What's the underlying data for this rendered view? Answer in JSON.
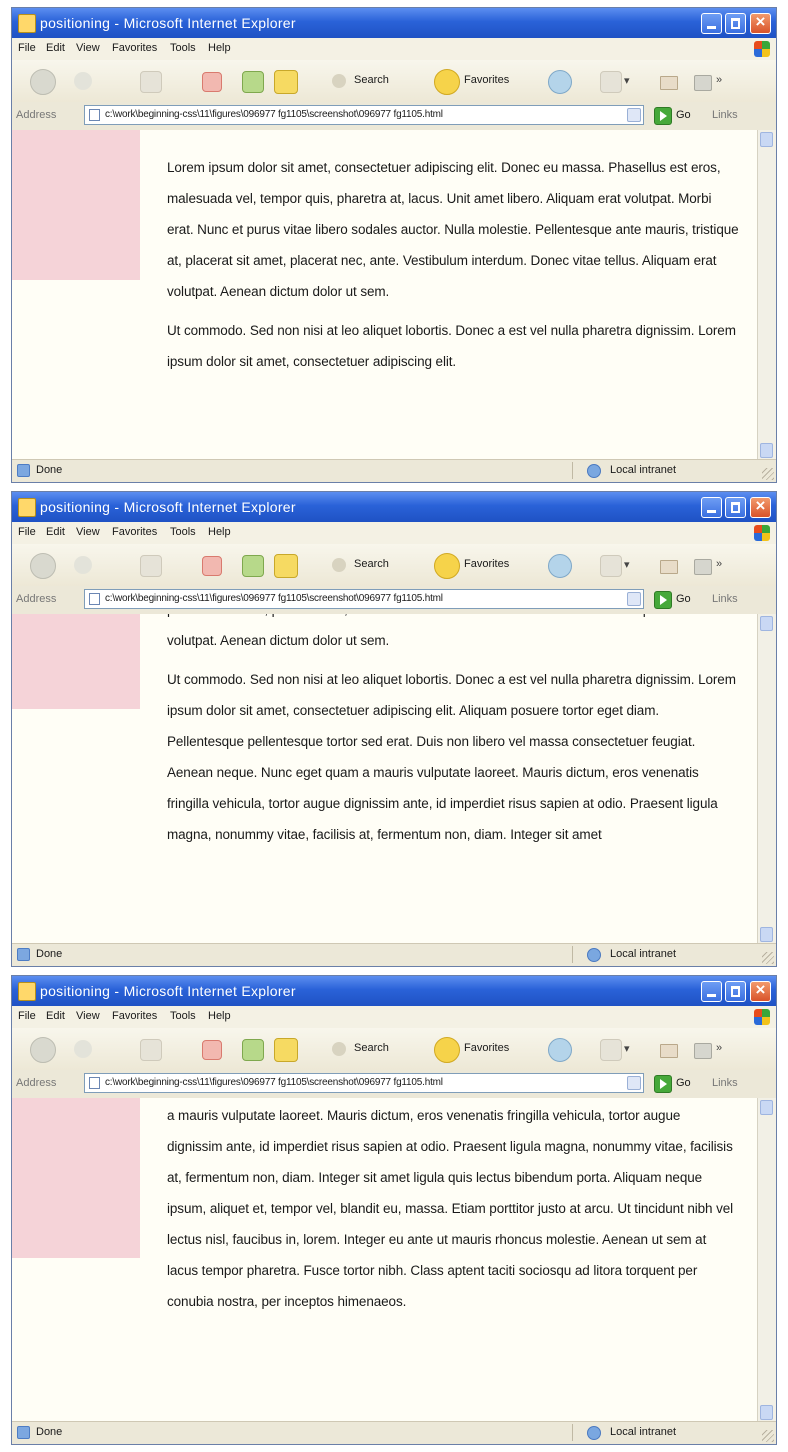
{
  "window": {
    "title": "positioning - Microsoft Internet Explorer"
  },
  "menu": [
    "File",
    "Edit",
    "View",
    "Favorites",
    "Tools",
    "Help"
  ],
  "toolbar": {
    "search_label": "Search",
    "favorites_label": "Favorites"
  },
  "address": {
    "label": "Address",
    "url": "c:\\work\\beginning-css\\11\\figures\\096977 fg1105\\screenshot\\096977 fg1105.html",
    "go_label": "Go",
    "links_label": "Links"
  },
  "status": {
    "text": "Done",
    "zone": "Local intranet"
  },
  "screens": [
    {
      "paragraphs": [
        "Lorem ipsum dolor sit amet, consectetuer adipiscing elit. Donec eu massa. Phasellus est eros, malesuada vel, tempor quis, pharetra at, lacus. Unit amet libero. Aliquam erat volutpat. Morbi erat. Nunc et purus vitae libero sodales auctor. Nulla molestie. Pellentesque ante mauris, tristique at, placerat sit amet, placerat nec, ante. Vestibulum interdum. Donec vitae tellus. Aliquam erat volutpat. Aenean dictum dolor ut sem.",
        "Ut commodo. Sed non nisi at leo aliquet lobortis. Donec a est vel nulla pharetra dignissim. Lorem ipsum dolor sit amet, consectetuer adipiscing elit."
      ]
    },
    {
      "paragraphs": [
        "placerat sit amet, placerat nec, ante. Vestibulum interdum. Donec vitae tellus. Aliquam erat volutpat. Aenean dictum dolor ut sem.",
        "Ut commodo. Sed non nisi at leo aliquet lobortis. Donec a est vel nulla pharetra dignissim. Lorem ipsum dolor sit amet, consectetuer adipiscing elit. Aliquam posuere tortor eget diam. Pellentesque pellentesque tortor sed erat. Duis non libero vel massa consectetuer feugiat. Aenean neque. Nunc eget quam a mauris vulputate laoreet. Mauris dictum, eros venenatis fringilla vehicula, tortor augue dignissim ante, id imperdiet risus sapien at odio. Praesent ligula magna, nonummy vitae, facilisis at, fermentum non, diam. Integer sit amet"
      ]
    },
    {
      "paragraphs": [
        "a mauris vulputate laoreet. Mauris dictum, eros venenatis fringilla vehicula, tortor augue dignissim ante, id imperdiet risus sapien at odio. Praesent ligula magna, nonummy vitae, facilisis at, fermentum non, diam. Integer sit amet ligula quis lectus bibendum porta. Aliquam neque ipsum, aliquet et, tempor vel, blandit eu, massa. Etiam porttitor justo at arcu. Ut tincidunt nibh vel lectus nisl, faucibus in, lorem. Integer eu ante ut mauris rhoncus molestie. Aenean ut sem at lacus tempor pharetra. Fusce tortor nibh. Class aptent taciti sociosqu ad litora torquent per conubia nostra, per inceptos himenaeos."
      ]
    }
  ]
}
